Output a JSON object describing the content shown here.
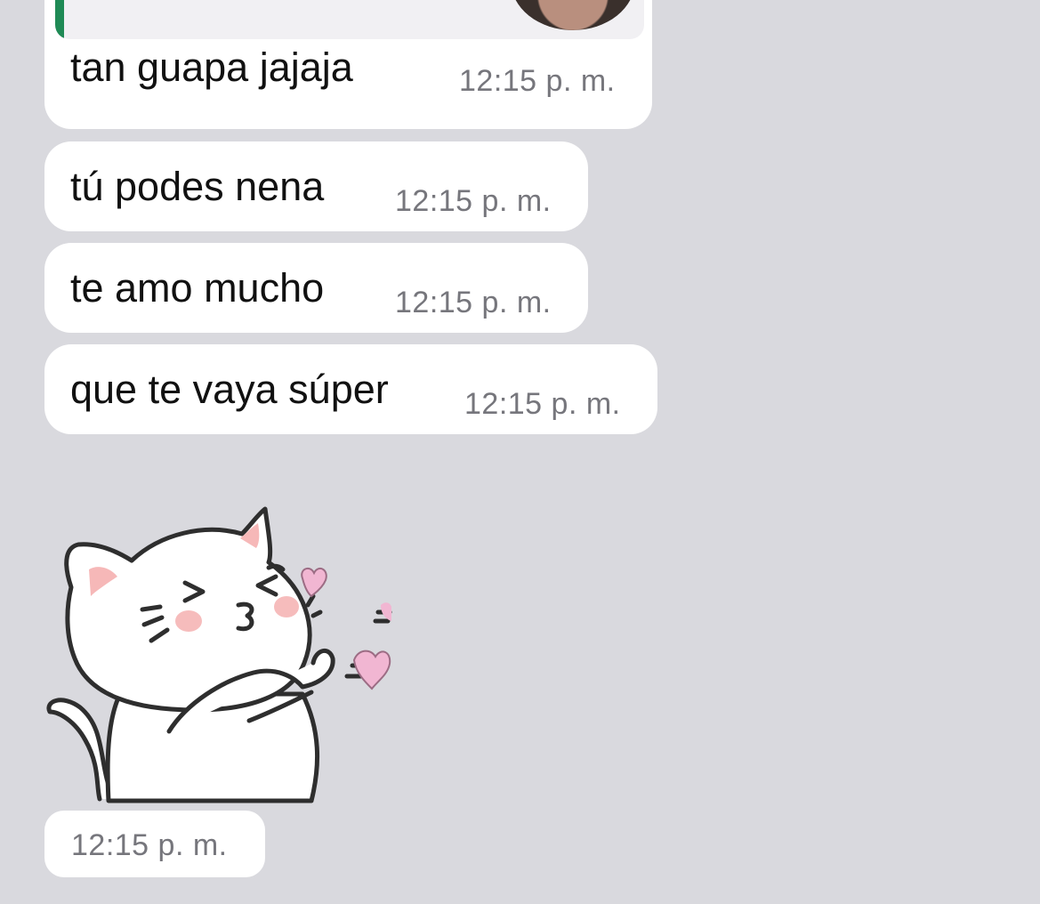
{
  "chat": {
    "messages": [
      {
        "text": "tan guapa jajaja",
        "time": "12:15 p. m."
      },
      {
        "text": "tú podes nena",
        "time": "12:15 p. m."
      },
      {
        "text": "te amo mucho",
        "time": "12:15 p. m."
      },
      {
        "text": "que te vaya súper",
        "time": "12:15 p. m."
      }
    ],
    "sticker": {
      "icon": "cat-blowing-kiss-sticker",
      "time": "12:15 p. m."
    }
  },
  "colors": {
    "background": "#d9d9de",
    "bubble": "#ffffff",
    "quote_bar": "#1f8a55",
    "time_text": "#76767c"
  }
}
